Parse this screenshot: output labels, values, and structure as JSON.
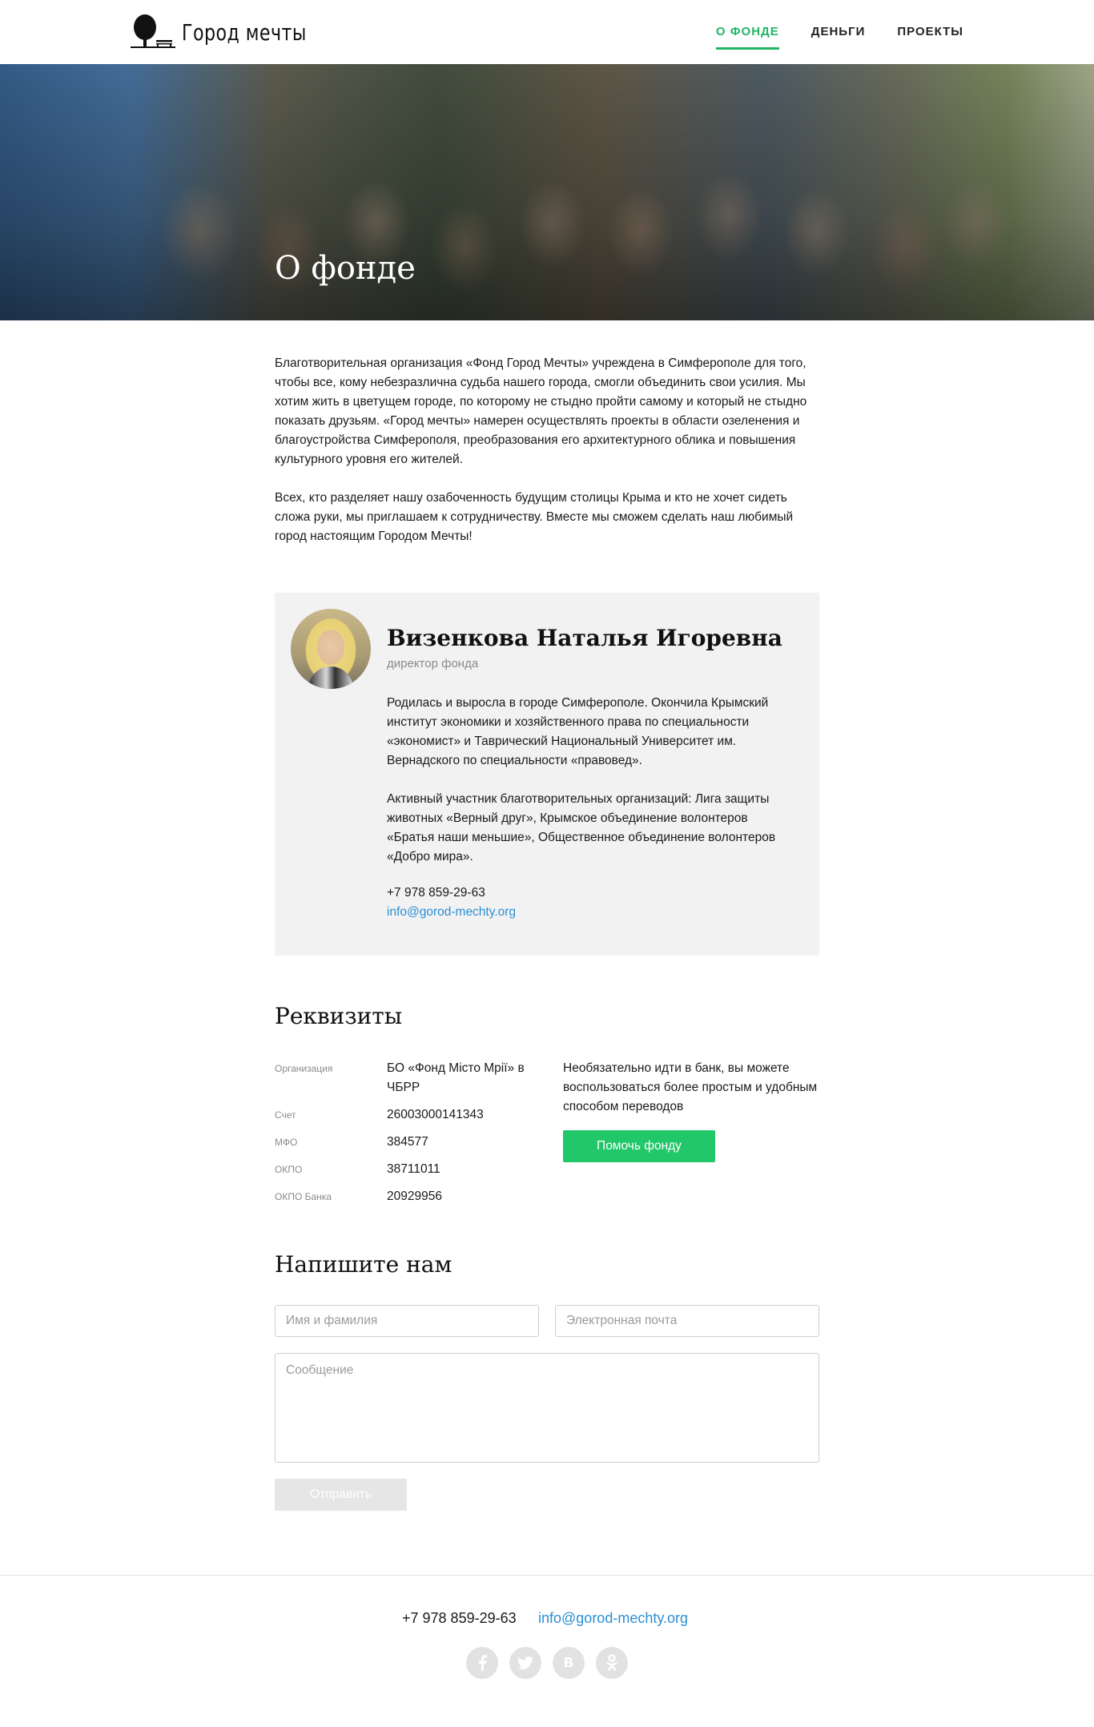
{
  "brand": {
    "name": "Город мечты",
    "logo_icon": "tree-bench-icon"
  },
  "nav": {
    "items": [
      {
        "label": "О фонде",
        "active": true
      },
      {
        "label": "Деньги",
        "active": false
      },
      {
        "label": "Проекты",
        "active": false
      }
    ],
    "accent_color": "#21b666"
  },
  "hero": {
    "title": "О фонде"
  },
  "intro": {
    "paragraphs": [
      "Благотворительная организация «Фонд Город Мечты» учреждена в Симферополе для того, чтобы все, кому небезразлична судьба нашего города, смогли объединить свои усилия. Мы хотим жить в цветущем городе, по которому не стыдно пройти самому и который не стыдно показать друзьям. «Город мечты» намерен осуществлять проекты в области озеленения и благоустройства Симферополя, преобразования его архитектурного облика и повышения культурного уровня его жителей.",
      "Всех, кто разделяет нашу озабоченность будущим столицы Крыма и кто не хочет сидеть сложа руки, мы приглашаем к сотрудничеству. Вместе мы сможем сделать наш любимый город настоящим Городом Мечты!"
    ]
  },
  "director": {
    "name": "Визенкова Наталья Игоревна",
    "role": "директор фонда",
    "bio": [
      "Родилась и выросла в городе Симферополе. Окончила Крымский институт экономики и хозяйственного права по специальности «экономист» и Таврический Национальный Университет им. Вернадского по специальности «правовед».",
      "Активный участник благотворительных организаций: Лига защиты животных «Верный друг», Крымское объединение волонтеров «Братья наши меньшие», Общественное объединение волонтеров «Добро мира»."
    ],
    "phone": "+7 978 859-29-63",
    "email": "info@gorod-mechty.org"
  },
  "requisites": {
    "title": "Реквизиты",
    "rows": [
      {
        "label": "Организация",
        "value": "БО «Фонд Місто Мрії» в ЧБРР"
      },
      {
        "label": "Счет",
        "value": "26003000141343"
      },
      {
        "label": "МФО",
        "value": "384577"
      },
      {
        "label": "ОКПО",
        "value": "38711011"
      },
      {
        "label": "ОКПО Банка",
        "value": "20929956"
      }
    ],
    "note": "Необязательно идти в банк, вы можете воспользоваться более простым и удобным способом переводов",
    "help_button": "Помочь фонду"
  },
  "contact_form": {
    "title": "Напишите нам",
    "name_placeholder": "Имя и фамилия",
    "email_placeholder": "Электронная почта",
    "message_placeholder": "Сообщение",
    "submit_label": "Отправить"
  },
  "footer": {
    "phone": "+7 978 859-29-63",
    "email": "info@gorod-mechty.org",
    "social": [
      {
        "name": "facebook-icon",
        "glyph": "f"
      },
      {
        "name": "twitter-icon",
        "glyph": "t"
      },
      {
        "name": "vk-icon",
        "glyph": "в"
      },
      {
        "name": "odnoklassniki-icon",
        "glyph": "ok"
      }
    ]
  }
}
